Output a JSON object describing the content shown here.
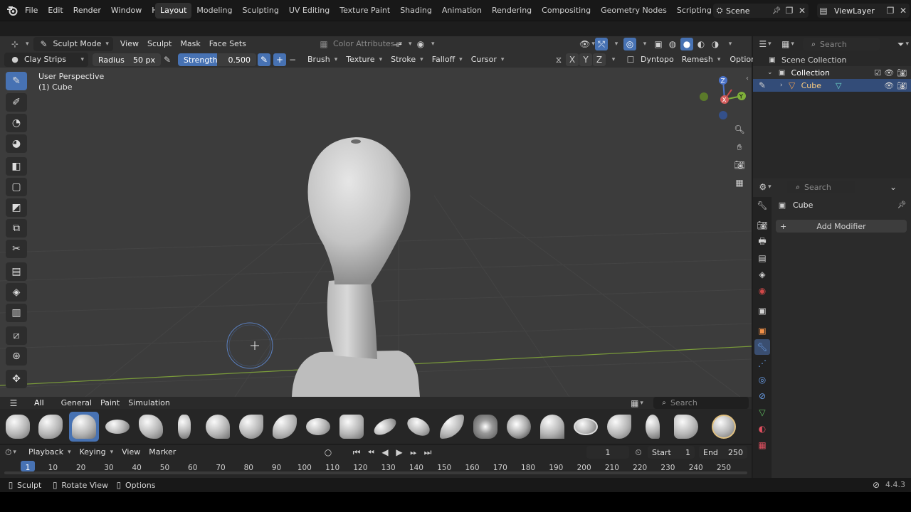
{
  "menus": [
    "File",
    "Edit",
    "Render",
    "Window",
    "Help"
  ],
  "workspaces": [
    "Layout",
    "Modeling",
    "Sculpting",
    "UV Editing",
    "Texture Paint",
    "Shading",
    "Animation",
    "Rendering",
    "Compositing",
    "Geometry Nodes",
    "Scripting"
  ],
  "active_workspace": "Layout",
  "scene": "Scene",
  "view_layer": "ViewLayer",
  "mode": "Sculpt Mode",
  "viewport_menus": [
    "View",
    "Sculpt",
    "Mask",
    "Face Sets"
  ],
  "color_attributes": "Color Attributes",
  "brush": {
    "name": "Clay Strips",
    "radius_label": "Radius",
    "radius_value": "50 px",
    "strength_label": "Strength",
    "strength_value": "0.500"
  },
  "brush_menus": [
    "Brush",
    "Texture",
    "Stroke",
    "Falloff",
    "Cursor"
  ],
  "symmetry": [
    "X",
    "Y",
    "Z"
  ],
  "dyntopo": "Dyntopo",
  "remesh": "Remesh",
  "options": "Options",
  "overlay_text": {
    "perspective": "User Perspective",
    "object": "(1) Cube"
  },
  "outliner": {
    "search_placeholder": "Search",
    "scene_collection": "Scene Collection",
    "collection": "Collection",
    "object": "Cube"
  },
  "properties": {
    "search_placeholder": "Search",
    "object": "Cube",
    "add_modifier": "Add Modifier"
  },
  "shelf_tabs": [
    "All",
    "General",
    "Paint",
    "Simulation"
  ],
  "shelf_search_placeholder": "Search",
  "timeline": {
    "menus": [
      "Playback",
      "Keying",
      "View",
      "Marker"
    ],
    "current_frame": "1",
    "start_label": "Start",
    "start": "1",
    "end_label": "End",
    "end": "250",
    "ticks": [
      "1",
      "10",
      "20",
      "30",
      "40",
      "50",
      "60",
      "70",
      "80",
      "90",
      "100",
      "110",
      "120",
      "130",
      "140",
      "150",
      "160",
      "170",
      "180",
      "190",
      "200",
      "210",
      "220",
      "230",
      "240",
      "250"
    ]
  },
  "status": {
    "items": [
      "Sculpt",
      "Rotate View",
      "Options"
    ],
    "version": "4.4.3"
  }
}
